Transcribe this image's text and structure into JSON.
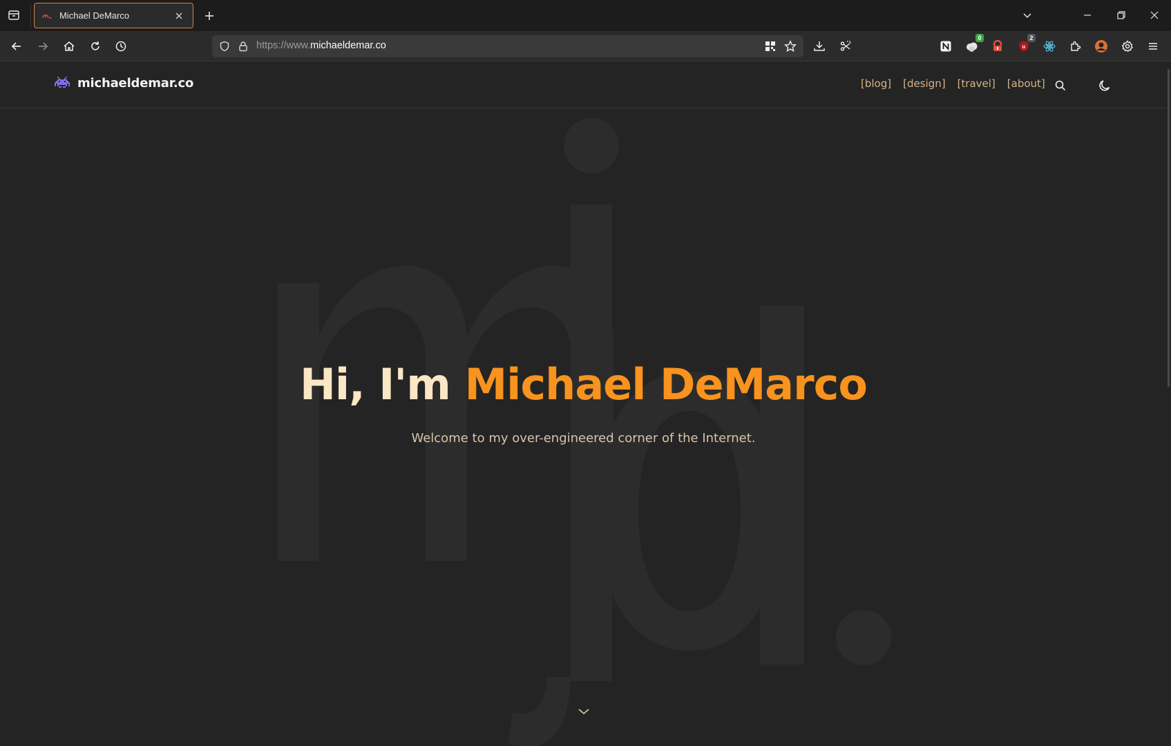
{
  "browser": {
    "tab": {
      "title": "Michael DeMarco"
    },
    "url": {
      "prefix": "https://www.",
      "domain": "michaeldemar.co"
    },
    "extensions": {
      "badge_green": "0",
      "badge_red": "2"
    }
  },
  "site": {
    "logo_text": "michaeldemar.co",
    "nav": {
      "blog": "[blog]",
      "design": "[design]",
      "travel": "[travel]",
      "about": "[about]"
    }
  },
  "hero": {
    "greeting": "Hi, I'm",
    "name": "Michael DeMarco",
    "subtitle": "Welcome to my over-engineered corner of the Internet."
  },
  "colors": {
    "accent": "#f7931e",
    "greeting": "#f9e7c6",
    "nav_link": "#d7b58b",
    "background": "#242424"
  }
}
